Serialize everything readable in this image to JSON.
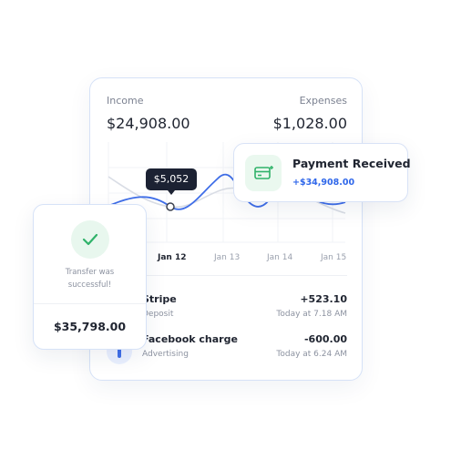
{
  "summary": {
    "income_label": "Income",
    "income_value": "$24,908.00",
    "expenses_label": "Expenses",
    "expenses_value": "$1,028.00"
  },
  "chart": {
    "tooltip": "$5,052",
    "dates": [
      "Jan 12",
      "Jan 13",
      "Jan 14",
      "Jan 15"
    ],
    "active_date": "Jan 12",
    "line_color": "#3f6ee8"
  },
  "transactions": [
    {
      "name": "Stripe",
      "type": "Deposit",
      "amount": "+523.10",
      "time": "Today at 7.18 AM"
    },
    {
      "name": "Facebook charge",
      "type": "Advertising",
      "amount": "-600.00",
      "time": "Today at 6.24 AM"
    }
  ],
  "payment": {
    "title": "Payment Received",
    "amount": "+$34,908.00",
    "icon": "card-icon",
    "amount_color": "#2f67ea"
  },
  "transfer": {
    "message": "Transfer was successful!",
    "amount": "$35,798.00",
    "icon": "check-icon",
    "success_color": "#30b36a"
  }
}
